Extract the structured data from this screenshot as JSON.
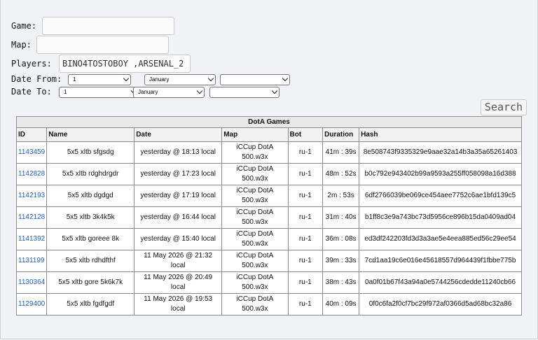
{
  "form": {
    "game_label": "Game:",
    "game_value": "",
    "map_label": "Map:",
    "map_value": "",
    "players_label": "Players:",
    "players_value": "BINO4TOSTOBOY ,ARSENAL_2",
    "date_from_label": "Date From:",
    "date_to_label": "Date To:",
    "from_day": "1",
    "from_month": "January",
    "from_year": "",
    "to_day": "1",
    "to_month": "January",
    "to_year": "",
    "search_label": "Search"
  },
  "table": {
    "caption": "DotA Games",
    "headers": [
      "ID",
      "Name",
      "Date",
      "Map",
      "Bot",
      "Duration",
      "Hash"
    ],
    "rows": [
      {
        "id": "1143459",
        "name": "5x5 xltb sfgsdg",
        "date": "yesterday @ 18:13 local",
        "map": "iCCup DotA 500.w3x",
        "bot": "ru-1",
        "duration": "41m : 39s",
        "hash": "8e508743f9335329e9aae32a14b3a35a65261403"
      },
      {
        "id": "1142828",
        "name": "5x5 xltb rdghdrgdr",
        "date": "yesterday @ 17:23 local",
        "map": "iCCup DotA 500.w3x",
        "bot": "ru-1",
        "duration": "48m : 52s",
        "hash": "b0c792e943402b99a9593a255ff058098a16d388"
      },
      {
        "id": "1142193",
        "name": "5x5 xltb dgdgd",
        "date": "yesterday @ 17:19 local",
        "map": "iCCup DotA 500.w3x",
        "bot": "ru-1",
        "duration": "2m : 53s",
        "hash": "6df2766039be069ce454aee7752c6ae1bfd139c5"
      },
      {
        "id": "1142128",
        "name": "5x5 xltb 3k4k5k",
        "date": "yesterday @ 16:44 local",
        "map": "iCCup DotA 500.w3x",
        "bot": "ru-1",
        "duration": "31m : 40s",
        "hash": "b1ff8c3e9a743bc73d5956ce896b15da0409ad04"
      },
      {
        "id": "1141392",
        "name": "5x5 xltb goreee 8k",
        "date": "yesterday @ 15:40 local",
        "map": "iCCup DotA 500.w3x",
        "bot": "ru-1",
        "duration": "36m : 08s",
        "hash": "ed3df242203fd3d3a3ae5e4eea885ed56c29ee54"
      },
      {
        "id": "1131199",
        "name": "5x5 xltb rdhdfthf",
        "date": "11 May 2026 @ 21:32 local",
        "map": "iCCup DotA 500.w3x",
        "bot": "ru-1",
        "duration": "39m : 33s",
        "hash": "7cd1aa19c6e016e45618557d964439f1fbbe775b"
      },
      {
        "id": "1130364",
        "name": "5x5 xltb gore 5k6k7k",
        "date": "11 May 2026 @ 20:49 local",
        "map": "iCCup DotA 500.w3x",
        "bot": "ru-1",
        "duration": "38m : 43s",
        "hash": "0a0f01b67f43a94a0e5744256cdedde11240cb66"
      },
      {
        "id": "1129400",
        "name": "5x5 xltb fgdfgdf",
        "date": "11 May 2026 @ 19:53 local",
        "map": "iCCup DotA 500.w3x",
        "bot": "ru-1",
        "duration": "40m : 09s",
        "hash": "0f0c6fa2f0cf7bc29f972af0366d5ad68bc32a86"
      }
    ]
  }
}
